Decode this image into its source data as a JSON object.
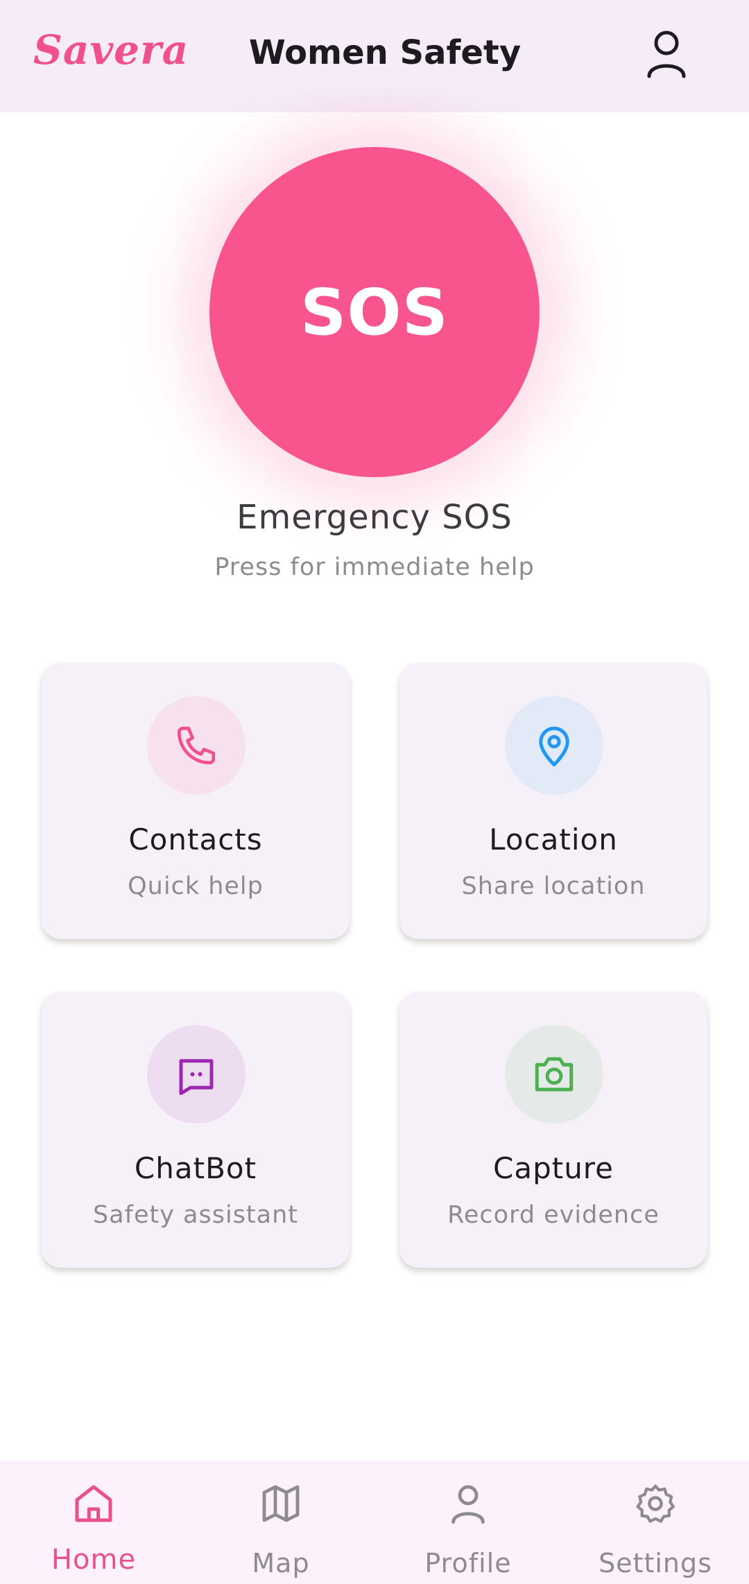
{
  "app": {
    "brand": "Savera",
    "title": "Women Safety"
  },
  "icons": {
    "profile": "user-icon"
  },
  "sos": {
    "button_label": "SOS",
    "title": "Emergency SOS",
    "subtitle": "Press for immediate help",
    "color": "#f8548e"
  },
  "actions": [
    {
      "title": "Contacts",
      "subtitle": "Quick help",
      "icon": "phone-icon",
      "icon_color": "#f0508e",
      "icon_bg": "#f7e1ee"
    },
    {
      "title": "Location",
      "subtitle": "Share location",
      "icon": "location-pin-icon",
      "icon_color": "#2196f3",
      "icon_bg": "#e2eaf8"
    },
    {
      "title": "ChatBot",
      "subtitle": "Safety assistant",
      "icon": "chat-icon",
      "icon_color": "#9c27b0",
      "icon_bg": "#eedcf1"
    },
    {
      "title": "Capture",
      "subtitle": "Record evidence",
      "icon": "camera-icon",
      "icon_color": "#4caf50",
      "icon_bg": "#e5eae8"
    }
  ],
  "nav": [
    {
      "label": "Home",
      "icon": "home-icon",
      "active": true
    },
    {
      "label": "Map",
      "icon": "map-icon",
      "active": false
    },
    {
      "label": "Profile",
      "icon": "person-icon",
      "active": false
    },
    {
      "label": "Settings",
      "icon": "gear-icon",
      "active": false
    }
  ],
  "colors": {
    "accent": "#f0508e",
    "appbar_bg": "#f5ecf8",
    "nav_bg": "#fdf2fb",
    "card_bg": "#f6f0f8"
  }
}
